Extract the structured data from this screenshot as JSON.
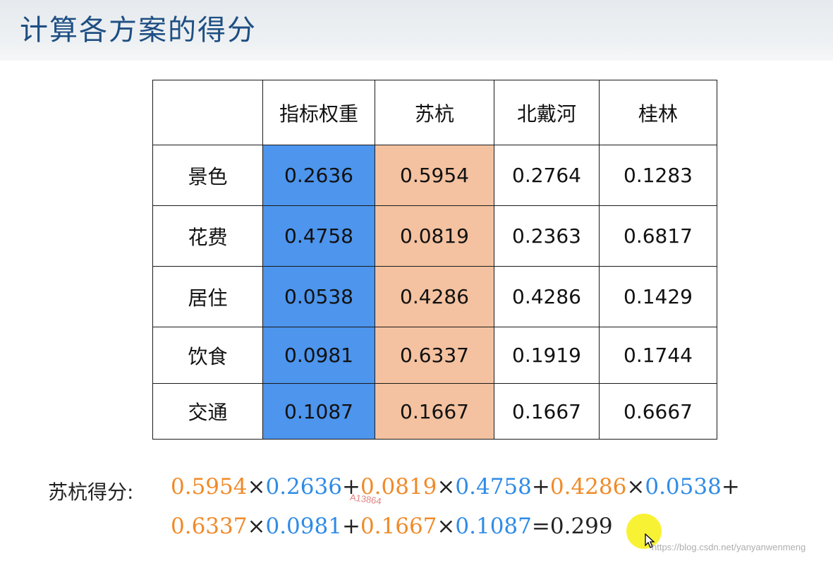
{
  "header": {
    "title": "计算各方案的得分"
  },
  "table": {
    "columns": [
      "",
      "指标权重",
      "苏杭",
      "北戴河",
      "桂林"
    ],
    "rows": [
      {
        "label": "景色",
        "weight": "0.2636",
        "suhang": "0.5954",
        "beidaihe": "0.2764",
        "guilin": "0.1283"
      },
      {
        "label": "花费",
        "weight": "0.4758",
        "suhang": "0.0819",
        "beidaihe": "0.2363",
        "guilin": "0.6817"
      },
      {
        "label": "居住",
        "weight": "0.0538",
        "suhang": "0.4286",
        "beidaihe": "0.4286",
        "guilin": "0.1429"
      },
      {
        "label": "饮食",
        "weight": "0.0981",
        "suhang": "0.6337",
        "beidaihe": "0.1919",
        "guilin": "0.1744"
      },
      {
        "label": "交通",
        "weight": "0.1087",
        "suhang": "0.1667",
        "beidaihe": "0.1667",
        "guilin": "0.6667"
      }
    ]
  },
  "formula": {
    "label": "苏杭得分:",
    "line1": [
      "0.5954",
      "×",
      "0.2636",
      "+",
      "0.0819",
      "×",
      "0.4758",
      "+",
      "0.4286",
      "×",
      "0.0538",
      "+"
    ],
    "line2": [
      "0.6337",
      "×",
      "0.0981",
      "+",
      "0.1667",
      "×",
      "0.1087",
      "=",
      "0.299"
    ]
  },
  "watermarks": {
    "id": "A13864",
    "url": "https://blog.csdn.net/yanyanwenmeng"
  },
  "colors": {
    "title": "#1e4f83",
    "weight_column": "#4d95ed",
    "suhang_column": "#f4c2a0",
    "formula_orange": "#f08a28",
    "formula_blue": "#2f8be6",
    "cursor_highlight": "#f8f12a"
  },
  "icons": {
    "cursor": "mouse-pointer-icon"
  }
}
